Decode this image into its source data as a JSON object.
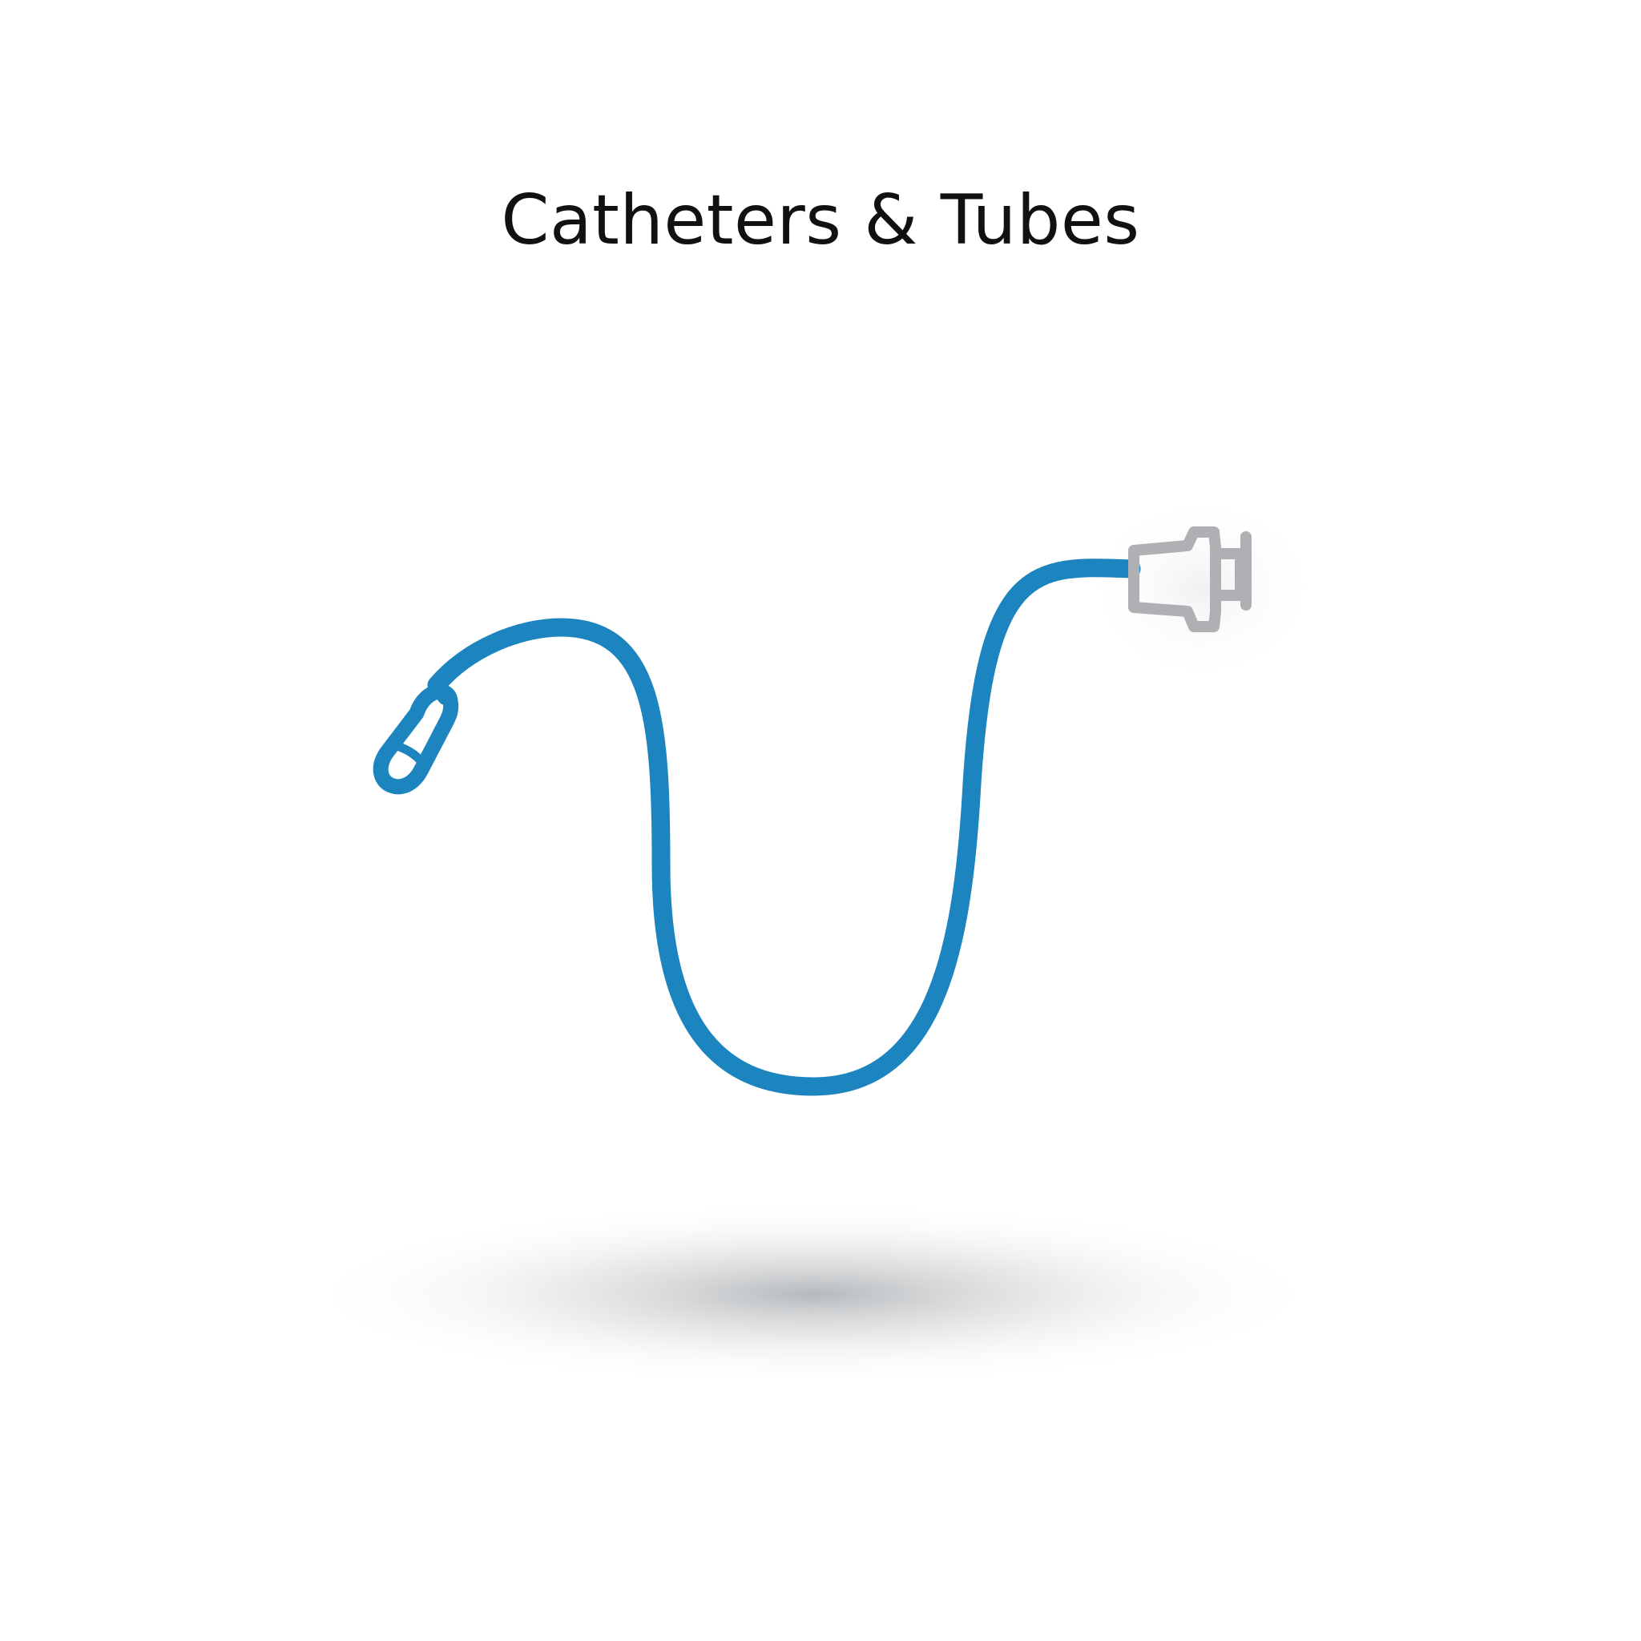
{
  "title": "Catheters & Tubes",
  "colors": {
    "background": "#ffffff",
    "tube": "#1c84bf",
    "connector": "#aeb0b3",
    "shadow": "#9ea2a6",
    "title": "#111111"
  },
  "icons": {
    "catheter": "catheter-tube-icon",
    "tip": "catheter-tip-icon",
    "connector": "luer-connector-icon"
  }
}
